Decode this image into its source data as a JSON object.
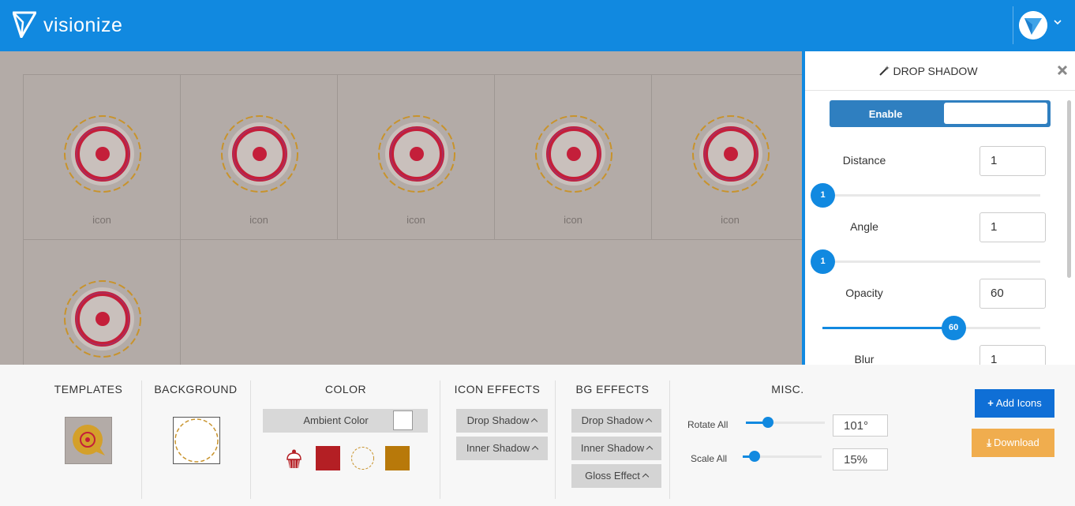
{
  "header": {
    "brand": "visionize"
  },
  "canvas": {
    "cells": [
      {
        "label": "icon"
      },
      {
        "label": "icon"
      },
      {
        "label": "icon"
      },
      {
        "label": "icon"
      },
      {
        "label": "icon"
      },
      {
        "label": ""
      }
    ]
  },
  "panel": {
    "title": "DROP SHADOW",
    "enable_label": "Enable",
    "props": [
      {
        "label": "Distance",
        "value": "1",
        "slider": "1",
        "fraction": 0
      },
      {
        "label": "Angle",
        "value": "1",
        "slider": "1",
        "fraction": 0
      },
      {
        "label": "Opacity",
        "value": "60",
        "slider": "60",
        "fraction": 0.6
      },
      {
        "label": "Blur",
        "value": "1"
      }
    ]
  },
  "toolbar": {
    "templates_title": "TEMPLATES",
    "background_title": "BACKGROUND",
    "color_title": "COLOR",
    "ambient_color_label": "Ambient Color",
    "icon_effects_title": "ICON EFFECTS",
    "icon_effects": [
      "Drop Shadow",
      "Inner Shadow"
    ],
    "bg_effects_title": "BG EFFECTS",
    "bg_effects": [
      "Drop Shadow",
      "Inner Shadow",
      "Gloss Effect"
    ],
    "misc_title": "MISC.",
    "rotate_label": "Rotate All",
    "rotate_value": "101°",
    "rotate_fraction": 0.28,
    "scale_label": "Scale All",
    "scale_value": "15%",
    "scale_fraction": 0.15,
    "add_icons_label": "Add Icons",
    "download_label": "Download"
  },
  "colors": {
    "header_blue": "#1189e0",
    "swatch_red": "#b41f24",
    "swatch_gold": "#b8790a",
    "ring_dash": "#c8932c"
  }
}
